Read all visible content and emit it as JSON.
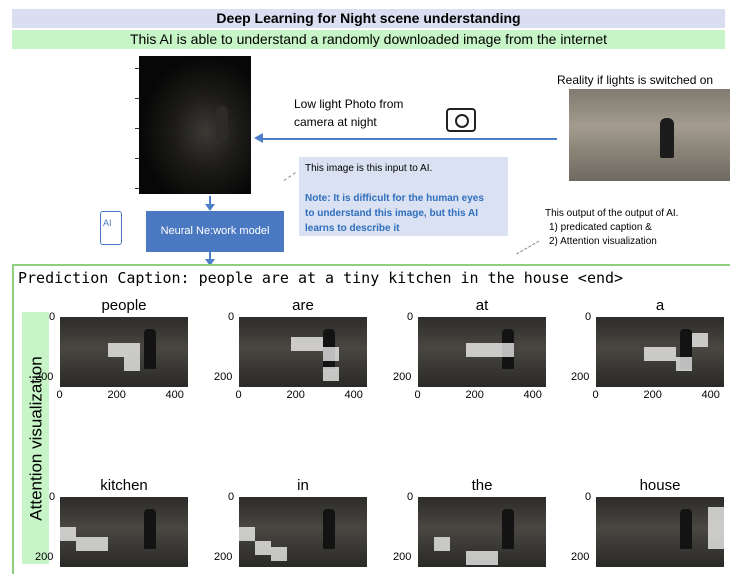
{
  "header": {
    "title": "Deep Learning for Night scene understanding",
    "subtitle": "This AI is able to understand a randomly downloaded image from the internet"
  },
  "top": {
    "reality_label": "Reality if lights is switched on",
    "low_light_label_1": "Low light Photo from",
    "low_light_label_2": "camera at night",
    "camera_icon": "camera-icon",
    "info_input": "This image is this input to AI.",
    "info_note_1": "Note: It is difficult for the human eyes",
    "info_note_2": "to understand this image, but this AI",
    "info_note_3": "learns to describe it",
    "model_label": "Neural Ne:work model",
    "output_1": "This output of the output of AI.",
    "output_2": "1)   predicated caption &",
    "output_3": "2)   Attention visualization"
  },
  "main": {
    "prediction_caption": "Prediction Caption: people are at a tiny kitchen in the house <end>",
    "attention_label": "Attention visualization",
    "y_ticks": [
      "0",
      "200"
    ],
    "x_ticks": [
      "0",
      "200",
      "400"
    ],
    "words": [
      "people",
      "are",
      "at",
      "a",
      "kitchen",
      "in",
      "the",
      "house"
    ]
  },
  "colors": {
    "title_bg": "#d9dff1",
    "subtitle_bg": "#c8f5c8",
    "model_box": "#4a79c2",
    "note_text": "#2f6fbd",
    "panel_border": "#8fd07f"
  }
}
